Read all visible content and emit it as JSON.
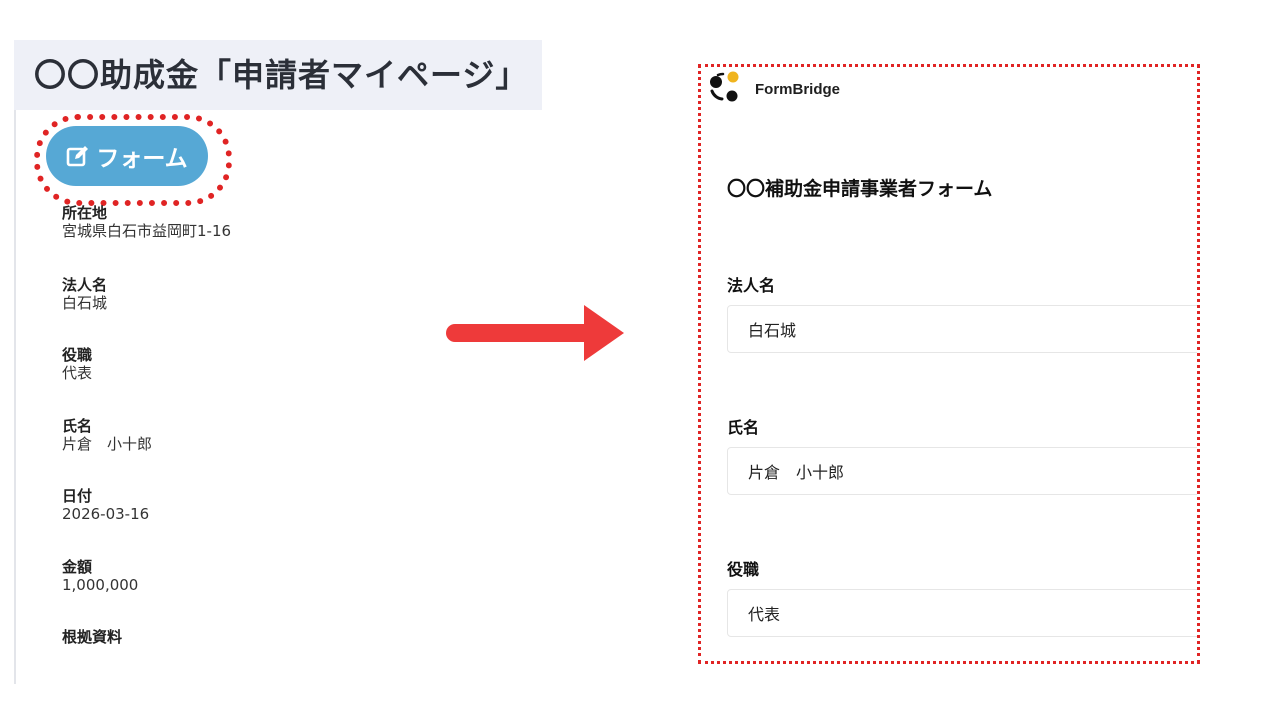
{
  "left": {
    "title": "〇〇助成金「申請者マイページ」",
    "form_button_label": "フォーム",
    "fields": [
      {
        "label": "所在地",
        "value": "宮城県白石市益岡町1-16"
      },
      {
        "label": "法人名",
        "value": "白石城"
      },
      {
        "label": "役職",
        "value": "代表"
      },
      {
        "label": "氏名",
        "value": "片倉　小十郎"
      },
      {
        "label": "日付",
        "value": "2026-03-16"
      },
      {
        "label": "金額",
        "value": "1,000,000"
      },
      {
        "label": "根拠資料",
        "value": ""
      }
    ]
  },
  "right": {
    "brand": "FormBridge",
    "form_title": "〇〇補助金申請事業者フォーム",
    "fields": [
      {
        "label": "法人名",
        "value": "白石城"
      },
      {
        "label": "氏名",
        "value": "片倉　小十郎"
      },
      {
        "label": "役職",
        "value": "代表"
      }
    ]
  },
  "colors": {
    "form_button": "#56a8d5",
    "highlight": "#e02424",
    "arrow": "#ee3a3a",
    "header_bg": "#eef0f7",
    "logo_accent": "#f0b41e"
  },
  "icons": {
    "form_button_icon": "edit-icon",
    "arrow": "arrow-right-icon",
    "logo": "formbridge-logo-icon"
  }
}
